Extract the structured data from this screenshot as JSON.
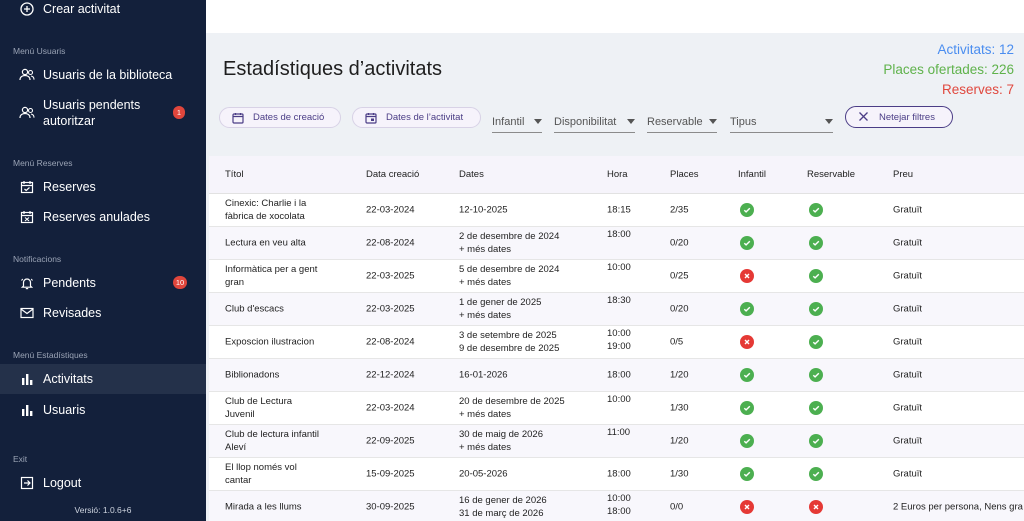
{
  "sidebar": {
    "create": "Crear activitat",
    "sections": {
      "users": "Menú Usuaris",
      "reservations": "Menú Reserves",
      "notifications": "Notificacions",
      "stats": "Menú Estadístiques",
      "exit": "Exit"
    },
    "items": {
      "library_users": "Usuaris de la biblioteca",
      "pending_users": "Usuaris pendents autoritzar",
      "pending_users_badge": "1",
      "reservations": "Reserves",
      "cancelled_reservations": "Reserves anulades",
      "pending": "Pendents",
      "pending_badge": "10",
      "reviewed": "Revisades",
      "activities": "Activitats",
      "users": "Usuaris",
      "logout": "Logout"
    },
    "version": "Versió: 1.0.6+6"
  },
  "header": {
    "title": "Estadístiques d’activitats",
    "stats": {
      "activities": "Activitats: 12",
      "places": "Places ofertades: 226",
      "reservations": "Reserves: 7"
    },
    "colors": {
      "activities": "#4a8df0",
      "places": "#5fb24b",
      "reservations": "#e0483e"
    }
  },
  "filters": {
    "creation_dates": "Dates de creació",
    "activity_dates": "Dates de l’activitat",
    "infantil": "Infantil",
    "availability": "Disponibilitat",
    "reservable": "Reservable",
    "type": "Tipus",
    "clear": "Netejar filtres"
  },
  "table": {
    "headers": [
      "Títol",
      "Data creació",
      "Dates",
      "Hora",
      "Places",
      "Infantil",
      "Reservable",
      "Preu"
    ],
    "rows": [
      {
        "title1": "Cinexic: Charlie i la",
        "title2": "fàbrica de xocolata",
        "created": "22-03-2024",
        "dates1": "12-10-2025",
        "dates2": "",
        "hour1": "18:15",
        "hour2": "",
        "places": "2/35",
        "infantil": true,
        "reservable": true,
        "price": "Gratuït"
      },
      {
        "title1": "Lectura en veu alta",
        "title2": "",
        "created": "22-08-2024",
        "dates1": "2 de desembre de 2024",
        "dates2": "+ més dates",
        "hour1": "18:00",
        "hour2": "",
        "places": "0/20",
        "infantil": true,
        "reservable": true,
        "price": "Gratuït"
      },
      {
        "title1": "Informàtica per a gent",
        "title2": "gran",
        "created": "22-03-2025",
        "dates1": "5 de desembre de 2024",
        "dates2": "+ més dates",
        "hour1": "10:00",
        "hour2": "",
        "places": "0/25",
        "infantil": false,
        "reservable": true,
        "price": "Gratuït"
      },
      {
        "title1": "Club d'escacs",
        "title2": "",
        "created": "22-03-2025",
        "dates1": "1 de gener de 2025",
        "dates2": "+ més dates",
        "hour1": "18:30",
        "hour2": "",
        "places": "0/20",
        "infantil": true,
        "reservable": true,
        "price": "Gratuït"
      },
      {
        "title1": "Exposcion ilustracion",
        "title2": "",
        "created": "22-08-2024",
        "dates1": "3 de setembre de 2025",
        "dates2": "9 de desembre de 2025",
        "hour1": "10:00",
        "hour2": "19:00",
        "places": "0/5",
        "infantil": false,
        "reservable": true,
        "price": "Gratuït"
      },
      {
        "title1": "Biblionadons",
        "title2": "",
        "created": "22-12-2024",
        "dates1": "16-01-2026",
        "dates2": "",
        "hour1": "18:00",
        "hour2": "",
        "places": "1/20",
        "infantil": true,
        "reservable": true,
        "price": "Gratuït"
      },
      {
        "title1": "Club de Lectura",
        "title2": "Juvenil",
        "created": "22-03-2024",
        "dates1": "20 de desembre de 2025",
        "dates2": "+ més dates",
        "hour1": "10:00",
        "hour2": "",
        "places": "1/30",
        "infantil": true,
        "reservable": true,
        "price": "Gratuït"
      },
      {
        "title1": "Club de lectura infantil",
        "title2": "Aleví",
        "created": "22-09-2025",
        "dates1": "30 de maig de 2026",
        "dates2": "+ més dates",
        "hour1": "11:00",
        "hour2": "",
        "places": "1/20",
        "infantil": true,
        "reservable": true,
        "price": "Gratuït"
      },
      {
        "title1": "El llop només vol",
        "title2": "cantar",
        "created": "15-09-2025",
        "dates1": "20-05-2026",
        "dates2": "",
        "hour1": "18:00",
        "hour2": "",
        "places": "1/30",
        "infantil": true,
        "reservable": true,
        "price": "Gratuït"
      },
      {
        "title1": "Mirada a les llums",
        "title2": "",
        "created": "30-09-2025",
        "dates1": "16 de gener de 2026",
        "dates2": "31 de març de 2026",
        "hour1": "10:00",
        "hour2": "18:00",
        "places": "0/0",
        "infantil": false,
        "reservable": false,
        "price": "2 Euros per persona, Nens gra"
      }
    ]
  },
  "icons": {
    "create": "plus-circle-icon",
    "library_users": "users-icon",
    "pending_users": "users-pending-icon",
    "reservations": "calendar-check-icon",
    "cancelled": "calendar-x-icon",
    "pending": "bell-icon",
    "reviewed": "mail-icon",
    "activities": "bar-chart-icon",
    "users": "bar-chart-icon",
    "logout": "logout-icon",
    "date_filter": "calendar-icon",
    "clear": "close-icon",
    "yes": "check-circle-icon",
    "no": "x-circle-icon"
  }
}
